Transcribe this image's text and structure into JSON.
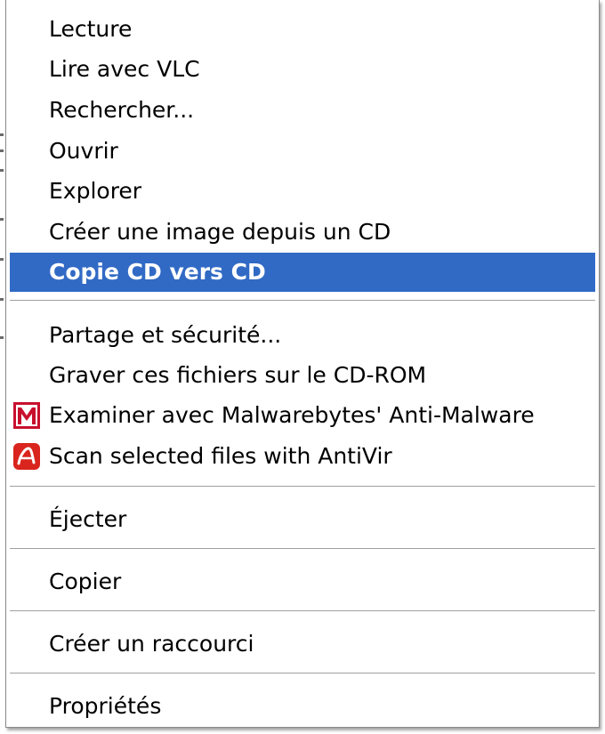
{
  "menu": {
    "items": [
      {
        "label": "Lecture"
      },
      {
        "label": "Lire avec VLC"
      },
      {
        "label": "Rechercher..."
      },
      {
        "label": "Ouvrir"
      },
      {
        "label": "Explorer"
      },
      {
        "label": "Créer une image depuis un CD"
      },
      {
        "label": "Copie CD vers CD"
      },
      {
        "label": "Partage et sécurité..."
      },
      {
        "label": "Graver ces fichiers sur le CD-ROM"
      },
      {
        "label": "Examiner avec Malwarebytes' Anti-Malware",
        "icon": "malwarebytes-icon"
      },
      {
        "label": "Scan selected files with AntiVir",
        "icon": "antivir-icon"
      },
      {
        "label": "Éjecter"
      },
      {
        "label": "Copier"
      },
      {
        "label": "Créer un raccourci"
      },
      {
        "label": "Propriétés"
      }
    ],
    "selected_index": 6,
    "colors": {
      "highlight": "#316ac5",
      "highlight_text": "#ffffff",
      "text": "#000000",
      "malwarebytes_red": "#c8102e",
      "antivir_red": "#d9251d"
    }
  }
}
